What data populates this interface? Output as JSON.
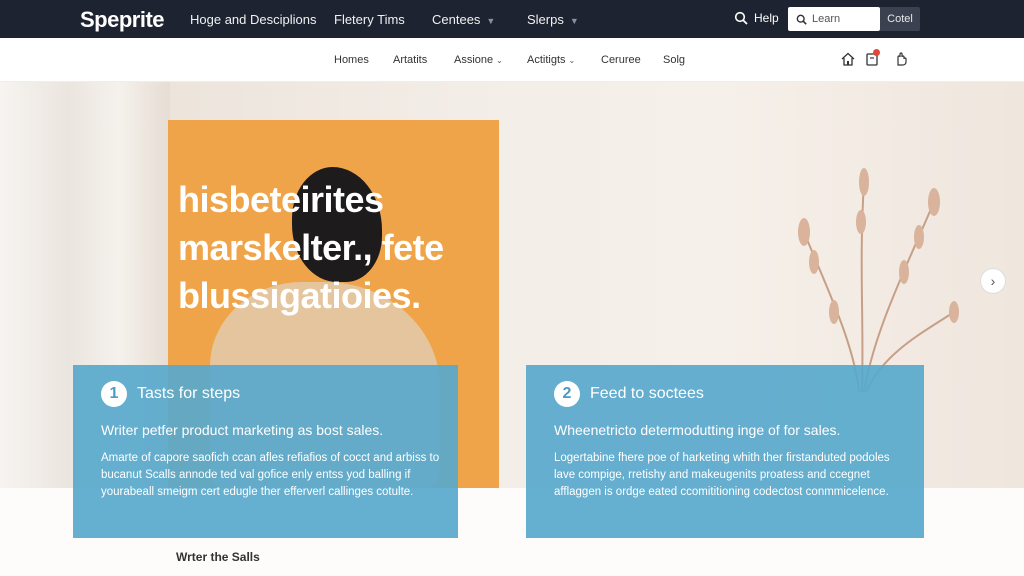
{
  "app": {
    "logo": "Speprite"
  },
  "topnav": {
    "items": [
      {
        "label": "Hoge and Desciplions",
        "has_caret": false
      },
      {
        "label": "Fletery Tims",
        "has_caret": false
      },
      {
        "label": "Centees",
        "has_caret": true
      },
      {
        "label": "Slerps",
        "has_caret": true
      }
    ],
    "help_label": "Help",
    "search_placeholder": "Learn",
    "contact_label": "Cotel"
  },
  "subnav": {
    "items": [
      {
        "label": "Homes",
        "has_caret": false
      },
      {
        "label": "Artatits",
        "has_caret": false
      },
      {
        "label": "Assione",
        "has_caret": true
      },
      {
        "label": "Actitigts",
        "has_caret": true
      },
      {
        "label": "Cerureе",
        "has_caret": false
      },
      {
        "label": "Solg",
        "has_caret": false
      }
    ],
    "icons": [
      "home-icon",
      "notification-icon",
      "hand-icon"
    ]
  },
  "hero": {
    "title_lines": [
      "hisbeteirites",
      "marskelter., fete",
      "blussigatioies."
    ]
  },
  "cards": [
    {
      "number": "1",
      "title": "Tasts for steps",
      "subtitle": "Writer petfer product marketing as bost sales.",
      "body": "Amarte of capore saofich ccan afles refiafios of cocct and arbiss to bucanut Scalls annode ted val gofice enly entss yod balling if yourabeall smeigm cert edugle ther efferverl callinges cotulte."
    },
    {
      "number": "2",
      "title": "Feed to soctees",
      "subtitle": "Wheenetricto determodutting inge of for sales.",
      "body": "Logertabine fhere poe of harketing whith ther firstanduted podoles lave compige, rretishy and makeugenits proatess and ccegnet afflaggen is ordge eated ccomititioning codectost conmmicelence."
    }
  ],
  "lower": {
    "text": "Wrter the Salls"
  },
  "colors": {
    "topbar": "#1d2330",
    "hero_accent": "#f0a449",
    "card_blue": "#58a8cc",
    "notification": "#e0493a"
  }
}
